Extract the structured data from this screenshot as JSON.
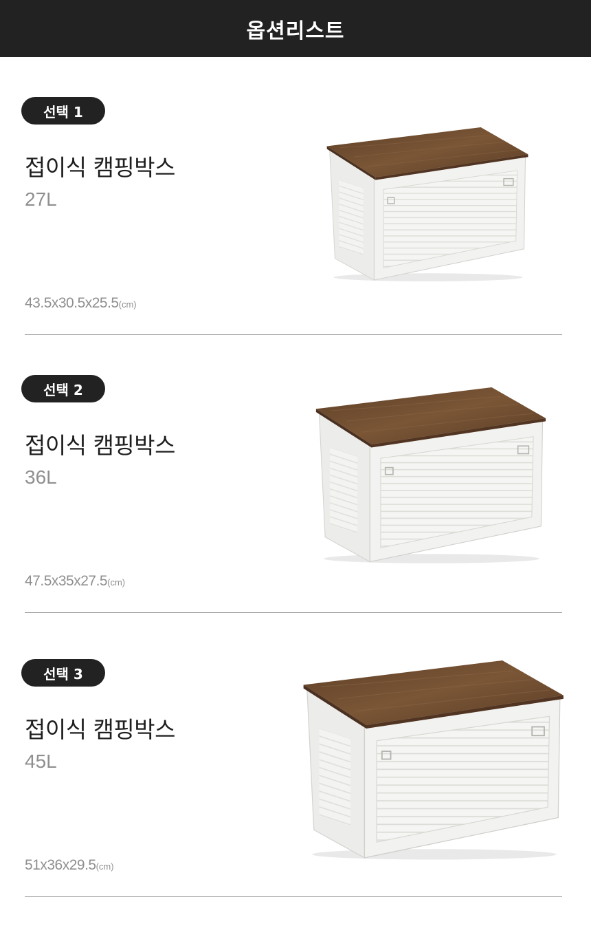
{
  "header": {
    "title": "옵션리스트"
  },
  "options": [
    {
      "badge": "선택 1",
      "name": "접이식 캠핑박스",
      "volume": "27L",
      "dims": "43.5x30.5x25.5",
      "unit": "(cm)"
    },
    {
      "badge": "선택 2",
      "name": "접이식 캠핑박스",
      "volume": "36L",
      "dims": "47.5x35x27.5",
      "unit": "(cm)"
    },
    {
      "badge": "선택 3",
      "name": "접이식 캠핑박스",
      "volume": "45L",
      "dims": "51x36x29.5",
      "unit": "(cm)"
    }
  ],
  "colors": {
    "header_bg": "#222222",
    "badge_bg": "#222222",
    "lid_wood": "#6b4a30",
    "box_white": "#f4f4f2"
  },
  "icons": {
    "product": "folding-camping-box-image"
  }
}
